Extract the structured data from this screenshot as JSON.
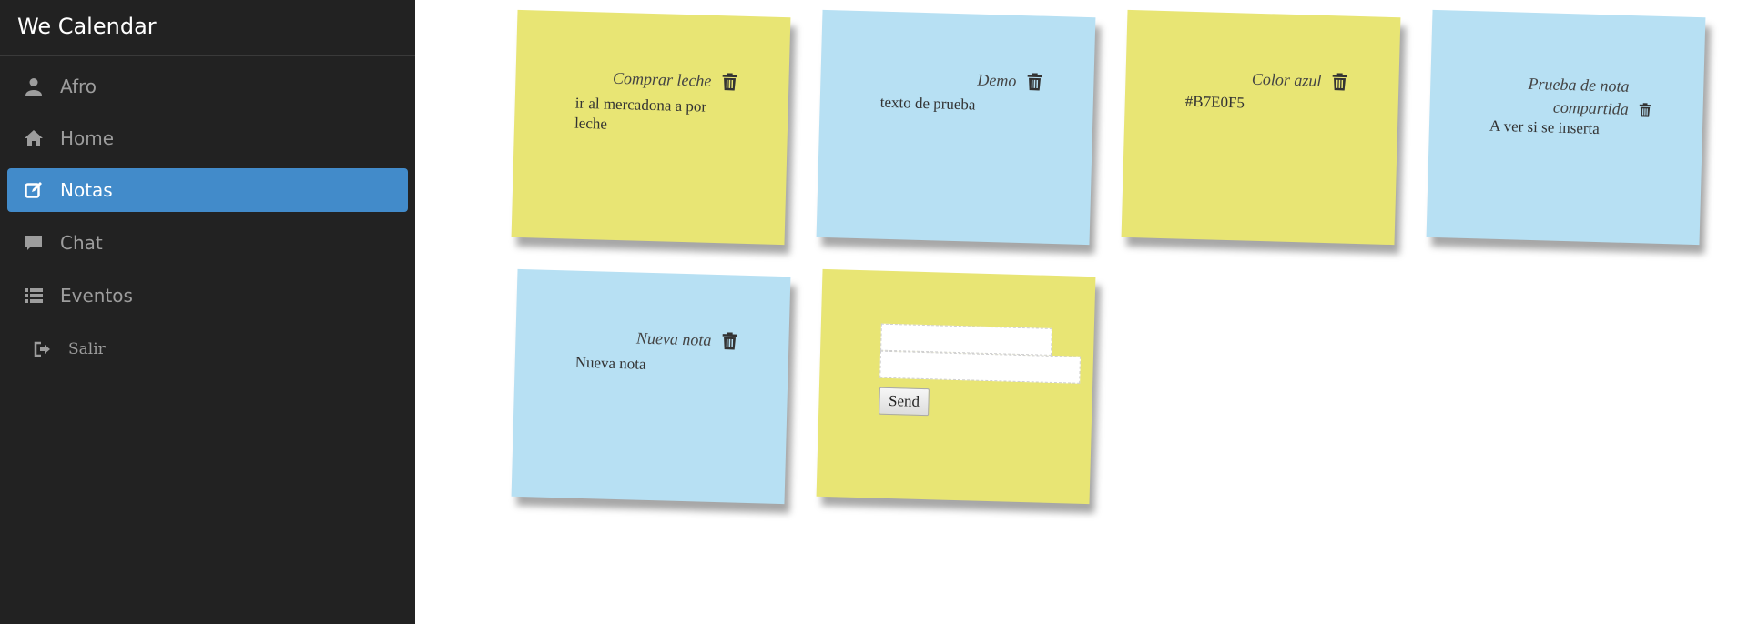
{
  "app": {
    "title": "We Calendar"
  },
  "nav": {
    "items": [
      {
        "label": "Afro",
        "icon": "user-icon"
      },
      {
        "label": "Home",
        "icon": "home-icon"
      },
      {
        "label": "Notas",
        "icon": "edit-icon",
        "active": true
      },
      {
        "label": "Chat",
        "icon": "comment-icon"
      },
      {
        "label": "Eventos",
        "icon": "list-icon"
      },
      {
        "label": "Salir",
        "icon": "logout-icon"
      }
    ]
  },
  "notes": [
    {
      "title": "Comprar leche",
      "body": "ir al mercadona a por leche",
      "color": "#e8e574",
      "icon": "trash-icon"
    },
    {
      "title": "Demo",
      "body": "texto de prueba",
      "color": "#b7e0f3",
      "icon": "trash-icon"
    },
    {
      "title": "Color azul",
      "body": "#B7E0F5",
      "color": "#e8e574",
      "icon": "trash-icon"
    },
    {
      "title": "Prueba de nota compartida",
      "body": "A ver si se inserta",
      "color": "#b7e0f3",
      "icon": "trash-icon"
    },
    {
      "title": "Nueva nota",
      "body": "Nueva nota",
      "color": "#b7e0f3",
      "icon": "trash-icon"
    }
  ],
  "new_note": {
    "title_value": "",
    "body_value": "",
    "send_label": "Send",
    "color": "#e8e574"
  },
  "colors": {
    "sidebar_bg": "#222222",
    "active_bg": "#428bca",
    "note_yellow": "#e8e574",
    "note_blue": "#b7e0f3"
  }
}
